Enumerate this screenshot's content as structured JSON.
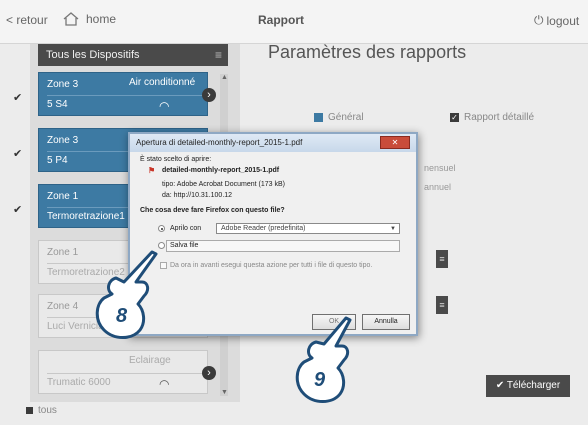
{
  "topbar": {
    "back_label": "retour",
    "home_label": "home",
    "title": "Rapport",
    "logout_label": "logout"
  },
  "sidebar": {
    "device_selector": "Tous les Dispositifs",
    "zones": [
      {
        "name": "Zone 3",
        "subtitle": "5 S4",
        "category": "Air conditionné",
        "active": true,
        "checked": true
      },
      {
        "name": "Zone 3",
        "subtitle": "5 P4",
        "category": "",
        "active": true,
        "checked": true
      },
      {
        "name": "Zone 1",
        "subtitle": "Termoretrazione1",
        "category": "",
        "active": true,
        "checked": true
      },
      {
        "name": "Zone 1",
        "subtitle": "Termoretrazione2",
        "category": "",
        "active": false,
        "checked": false
      },
      {
        "name": "Zone 4",
        "subtitle": "Luci Verniciatura",
        "category": "",
        "active": false,
        "checked": false
      },
      {
        "name": "",
        "subtitle": "Trumatic 6000",
        "category": "Eclairage",
        "active": false,
        "checked": false
      }
    ],
    "tous_label": "tous"
  },
  "main": {
    "title": "Paramètres des rapports",
    "option_general": "Général",
    "option_detail": "Rapport détaillé",
    "mensuel": "nensuel",
    "annuel": "annuel",
    "download_label": "Télécharger"
  },
  "dialog": {
    "title": "Apertura di detailed-monthly-report_2015-1.pdf",
    "intro": "È stato scelto di aprire:",
    "filename": "detailed-monthly-report_2015-1.pdf",
    "type_line": "tipo: Adobe Acrobat Document (173 kB)",
    "source_line": "da: http://10.31.100.12",
    "question": "Che cosa deve fare Firefox con questo file?",
    "open_with_label": "Aprilo con",
    "open_with_app": "Adobe Reader (predefinita)",
    "save_label": "Salva file",
    "remember_label": "Da ora in avanti esegui questa azione per tutti i file di questo tipo.",
    "ok_label": "OK",
    "cancel_label": "Annulla"
  },
  "callouts": {
    "c8": "8",
    "c9": "9"
  },
  "colors": {
    "accent": "#3d7aa3",
    "dark": "#4a4a4a",
    "dialog_close": "#c94c3a"
  }
}
